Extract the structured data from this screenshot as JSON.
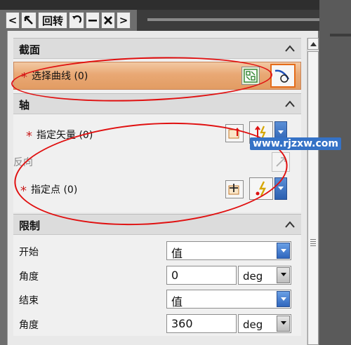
{
  "toolbar": {
    "back_label": "<",
    "return_label": "回转",
    "forward_label": ">"
  },
  "section1": {
    "title": "截面",
    "select_curve": {
      "label": "选择曲线 (0)"
    }
  },
  "section2": {
    "title": "轴",
    "specify_vector": {
      "label": "指定矢量 (0)"
    },
    "reverse": {
      "label": "反向"
    },
    "specify_point": {
      "label": "指定点 (0)"
    }
  },
  "section3": {
    "title": "限制",
    "start": {
      "label": "开始",
      "value": "值"
    },
    "start_angle": {
      "label": "角度",
      "value": "0",
      "unit": "deg"
    },
    "end": {
      "label": "结束",
      "value": "值"
    },
    "end_angle": {
      "label": "角度",
      "value": "360",
      "unit": "deg"
    }
  },
  "watermark": "www.rjzxw.com",
  "colors": {
    "highlight": "#e29c63",
    "required_star": "#c81e1e",
    "annotation": "#e01010",
    "dropdown_blue": "#2b5fb0"
  }
}
